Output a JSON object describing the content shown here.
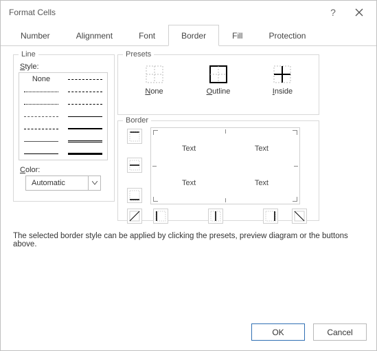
{
  "window": {
    "title": "Format Cells"
  },
  "tabs": {
    "number": "Number",
    "alignment": "Alignment",
    "font": "Font",
    "border": "Border",
    "fill": "Fill",
    "protection": "Protection",
    "active": "Border"
  },
  "line": {
    "group_label": "Line",
    "style_label": "Style:",
    "none_label": "None",
    "color_label": "Color:",
    "color_value": "Automatic"
  },
  "presets": {
    "group_label": "Presets",
    "none": "None",
    "outline": "Outline",
    "inside": "Inside"
  },
  "border": {
    "group_label": "Border",
    "preview_text": "Text"
  },
  "hint": "The selected border style can be applied by clicking the presets, preview diagram or the buttons above.",
  "buttons": {
    "ok": "OK",
    "cancel": "Cancel"
  }
}
